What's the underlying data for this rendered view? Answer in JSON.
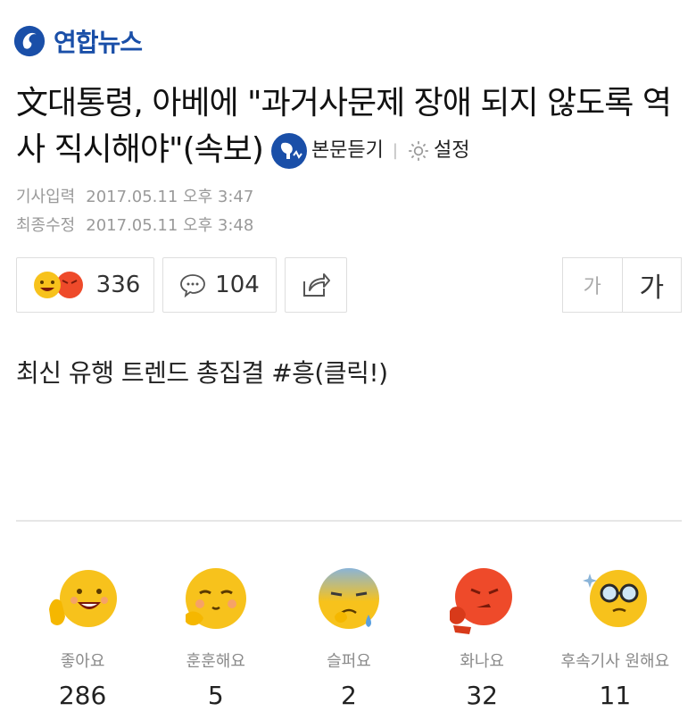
{
  "brand": {
    "name": "연합뉴스",
    "color": "#1a4fa8"
  },
  "article": {
    "headline": "文대통령, 아베에 \"과거사문제 장애 되지 않도록 역사 직시해야\"(속보)",
    "listen_label": "본문듣기",
    "settings_label": "설정",
    "input_label": "기사입력",
    "input_time": "2017.05.11 오후 3:47",
    "modified_label": "최종수정",
    "modified_time": "2017.05.11 오후 3:48"
  },
  "toolbar": {
    "reaction_count": "336",
    "comment_count": "104",
    "font_small_label": "가",
    "font_large_label": "가"
  },
  "promo": {
    "text": "최신 유행 트렌드 총집결 #흥(클릭!)"
  },
  "reactions": [
    {
      "label": "좋아요",
      "count": "286",
      "icon": "like-emoji-icon"
    },
    {
      "label": "훈훈해요",
      "count": "5",
      "icon": "warm-emoji-icon"
    },
    {
      "label": "슬퍼요",
      "count": "2",
      "icon": "sad-emoji-icon"
    },
    {
      "label": "화나요",
      "count": "32",
      "icon": "angry-emoji-icon"
    },
    {
      "label": "후속기사 원해요",
      "count": "11",
      "icon": "want-more-emoji-icon"
    }
  ],
  "colors": {
    "emoji_yellow": "#f7c21c",
    "emoji_red": "#ee4a2a",
    "sad_blue": "#8ab4d8"
  }
}
